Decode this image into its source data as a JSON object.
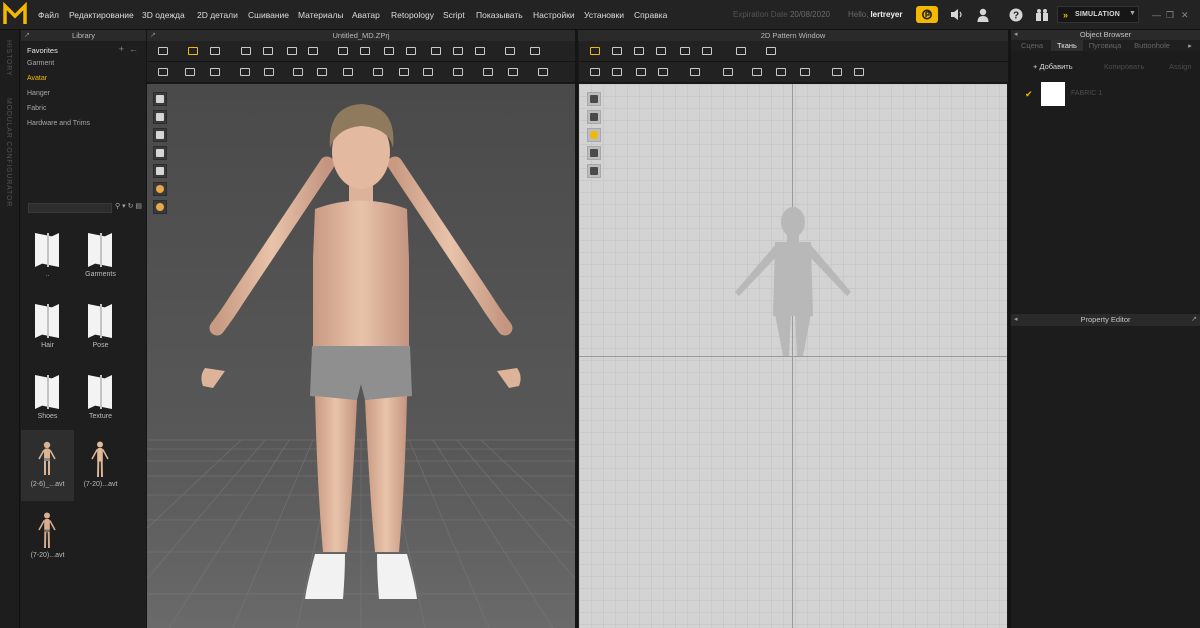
{
  "menu": {
    "logo_letter": "M",
    "items": [
      "Файл",
      "Редактирование",
      "3D одежда",
      "2D детали",
      "Сшивание",
      "Материалы",
      "Аватар",
      "Retopology",
      "Script",
      "Показывать",
      "Настройки",
      "Установки",
      "Справка"
    ],
    "expiration_label": "Expiration Date",
    "expiration_date": "20/08/2020",
    "hello_label": "Hello,",
    "username": "lertreyer",
    "simulation_label": "SIMULATION",
    "icons": [
      "cloud-icon",
      "speaker-icon",
      "user-icon",
      "help-icon",
      "gift-icon",
      "minimize-icon",
      "restore-icon",
      "close-icon"
    ],
    "accent_color": "#f5b800"
  },
  "side_tabs": [
    "HISTORY",
    "MODULAR CONFIGURATOR"
  ],
  "library": {
    "title": "Library",
    "favorites_header": "Favorites",
    "items": [
      {
        "label": "Garment",
        "active": false
      },
      {
        "label": "Avatar",
        "active": true
      },
      {
        "label": "Hanger",
        "active": false
      },
      {
        "label": "Fabric",
        "active": false
      },
      {
        "label": "Hardware and Trims",
        "active": false
      }
    ],
    "search_placeholder": "",
    "grid": [
      {
        "label": "..",
        "kind": "folder"
      },
      {
        "label": "Garments",
        "kind": "folder"
      },
      {
        "label": "Hair",
        "kind": "folder"
      },
      {
        "label": "Pose",
        "kind": "folder"
      },
      {
        "label": "Shoes",
        "kind": "folder"
      },
      {
        "label": "Texture",
        "kind": "folder"
      },
      {
        "label": "(2-6)_...avt",
        "kind": "avatar",
        "selected": true
      },
      {
        "label": "(7-20)...avt",
        "kind": "avatar",
        "selected": false
      },
      {
        "label": "(7-20)...avt",
        "kind": "avatar",
        "selected": false
      }
    ]
  },
  "view3d": {
    "title": "Untitled_MD.ZPrj",
    "side_tools": [
      "garment-view-icon",
      "texture-view-icon",
      "avatar-view-icon",
      "pattern-view-icon",
      "surface-view-icon",
      "skin-view-icon",
      "wire-view-icon"
    ]
  },
  "view2d": {
    "title": "2D Pattern Window",
    "side_tools": [
      "edit-pattern-icon",
      "pattern-transform-icon",
      "info-icon",
      "copy-pattern-icon",
      "layer-icon"
    ]
  },
  "object_browser": {
    "title": "Object Browser",
    "tabs": [
      {
        "label": "Сцена",
        "active": false
      },
      {
        "label": "Ткань",
        "active": true
      },
      {
        "label": "Пуговица",
        "active": false
      },
      {
        "label": "Buttonhole",
        "active": false
      }
    ],
    "actions": [
      {
        "label": "+ Добавить",
        "enabled": true
      },
      {
        "label": "Копировать",
        "enabled": false
      },
      {
        "label": "Assign",
        "enabled": false
      }
    ],
    "fabrics": [
      {
        "name": "FABRIC 1",
        "color": "#ffffff",
        "checked": true
      }
    ]
  },
  "property_editor": {
    "title": "Property Editor"
  }
}
